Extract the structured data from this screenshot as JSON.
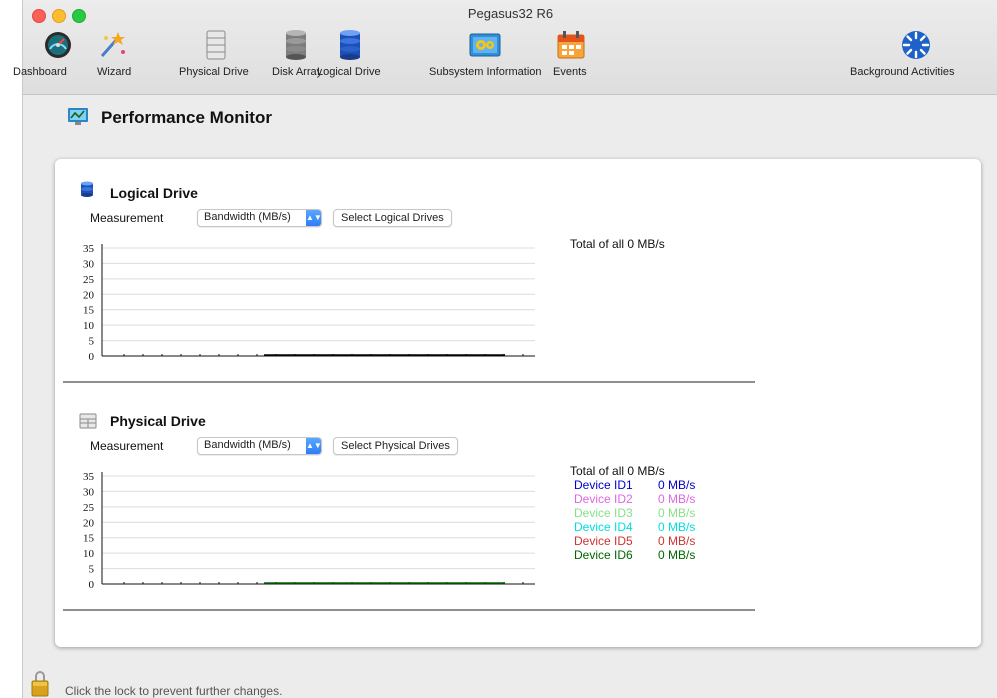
{
  "window": {
    "title": "Pegasus32 R6"
  },
  "toolbar": [
    {
      "label": "Dashboard",
      "icon": "dashboard-gauge-icon"
    },
    {
      "label": "Wizard",
      "icon": "wizard-icon"
    },
    {
      "label": "Physical Drive",
      "icon": "physical-drive-icon"
    },
    {
      "label": "Disk Array",
      "icon": "disk-array-icon"
    },
    {
      "label": "Logical Drive",
      "icon": "logical-drive-icon"
    },
    {
      "label": "Subsystem Information",
      "icon": "subsystem-information-icon"
    },
    {
      "label": "Events",
      "icon": "events-calendar-icon"
    },
    {
      "label": "Background Activities",
      "icon": "background-activities-icon"
    }
  ],
  "page": {
    "title": "Performance Monitor"
  },
  "logical": {
    "title": "Logical Drive",
    "measurement_label": "Measurement",
    "measurement_value": "Bandwidth (MB/s)",
    "select_button": "Select Logical Drives",
    "total": "Total of all 0 MB/s"
  },
  "physical": {
    "title": "Physical Drive",
    "measurement_label": "Measurement",
    "measurement_value": "Bandwidth (MB/s)",
    "select_button": "Select Physical Drives",
    "total": "Total of all 0 MB/s",
    "devices": [
      {
        "name": "Device ID1",
        "value": "0 MB/s",
        "color": "#0000cc"
      },
      {
        "name": "Device ID2",
        "value": "0 MB/s",
        "color": "#e066e0"
      },
      {
        "name": "Device ID3",
        "value": "0 MB/s",
        "color": "#88e088"
      },
      {
        "name": "Device ID4",
        "value": "0 MB/s",
        "color": "#00dede"
      },
      {
        "name": "Device ID5",
        "value": "0 MB/s",
        "color": "#cc3333"
      },
      {
        "name": "Device ID6",
        "value": "0 MB/s",
        "color": "#006600"
      }
    ]
  },
  "chart_data": [
    {
      "type": "line",
      "yticks": [
        "35",
        "30",
        "25",
        "20",
        "15",
        "10",
        "5",
        "0"
      ],
      "ylim": [
        0,
        35
      ],
      "grid": true,
      "series": [
        {
          "values": [
            0
          ],
          "color": "#000000"
        }
      ]
    },
    {
      "type": "line",
      "yticks": [
        "35",
        "30",
        "25",
        "20",
        "15",
        "10",
        "5",
        "0"
      ],
      "ylim": [
        0,
        35
      ],
      "grid": true,
      "series": [
        {
          "values": [
            0
          ],
          "color": "#006600"
        }
      ]
    }
  ],
  "footer": {
    "lock_text": "Click the lock to prevent further changes."
  }
}
